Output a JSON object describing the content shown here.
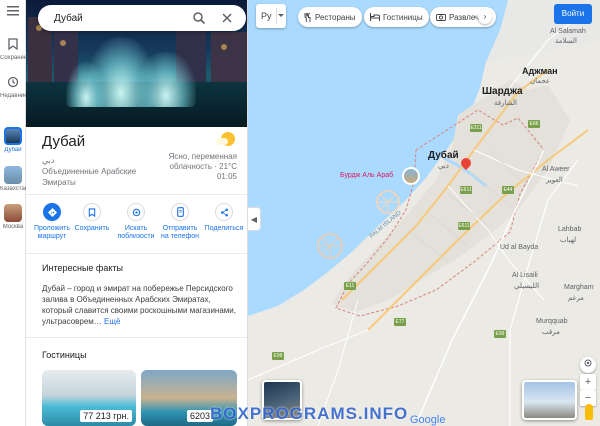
{
  "rail": {
    "menu_icon": "hamburger-icon",
    "items": [
      {
        "label": "Сохранено",
        "icon": "bookmark-icon"
      },
      {
        "label": "Недавние",
        "icon": "history-icon"
      },
      {
        "label": "Дубай"
      },
      {
        "label": "Казахстан"
      },
      {
        "label": "Москва"
      }
    ]
  },
  "search": {
    "value": "Дубай"
  },
  "place": {
    "title": "Дубай",
    "native_name": "دبي",
    "country": "Объединенные Арабские Эмираты",
    "weather_desc": "Ясно, переменная облачность · 21°C",
    "time": "01:05"
  },
  "actions": [
    {
      "label": "Проложить маршрут",
      "icon": "directions-icon"
    },
    {
      "label": "Сохранить",
      "icon": "bookmark-icon"
    },
    {
      "label": "Искать поблизости",
      "icon": "nearby-icon"
    },
    {
      "label": "Отправить на телефон",
      "icon": "phone-icon"
    },
    {
      "label": "Поделиться",
      "icon": "share-icon"
    }
  ],
  "facts": {
    "title": "Интересные факты",
    "text": "Дубай – город и эмират на побережье Персидского залива в Объединенных Арабских Эмиратах, который славится своими роскошными магазинами, ультрасоврем…",
    "more": "Ещё"
  },
  "hotels": {
    "title": "Гостиницы",
    "items": [
      {
        "price": "77 213 грн."
      },
      {
        "price": "6203"
      }
    ]
  },
  "map": {
    "lang": "Ру",
    "chips": [
      {
        "label": "Рестораны",
        "icon": "restaurant-icon"
      },
      {
        "label": "Гостиницы",
        "icon": "hotel-icon"
      },
      {
        "label": "Развлече",
        "icon": "camera-icon"
      }
    ],
    "signin": "Войти",
    "labels": {
      "al_salamah": "Al Salamah",
      "al_salamah_ar": "السلامة",
      "ajman": "Аджман",
      "ajman_ar": "عجمان",
      "sharjah": "Шарджа",
      "sharjah_ar": "الشارقة",
      "dubai": "Дубай",
      "dubai_ar": "دبي",
      "burj": "Бурдж Аль Араб",
      "al_aweer": "Al Aweer",
      "al_aweer_ar": "العوير",
      "lahbab": "Lahbab",
      "lahbab_ar": "لهباب",
      "ud_al_bayda": "Ud al Bayda",
      "al_lisaili": "Al Lisaili",
      "al_lisaili_ar": "الليسيلي",
      "margham": "Margham",
      "margham_ar": "مرغم",
      "murqquab": "Murqquab",
      "murqquab_ar": "مرقب",
      "palm_island": "PALM ISLAND"
    },
    "roads": [
      "E311",
      "E611",
      "E44",
      "E11",
      "E66",
      "E77",
      "E99"
    ],
    "google": "Google"
  },
  "watermark": "BOXPROGRAMS.INFO"
}
